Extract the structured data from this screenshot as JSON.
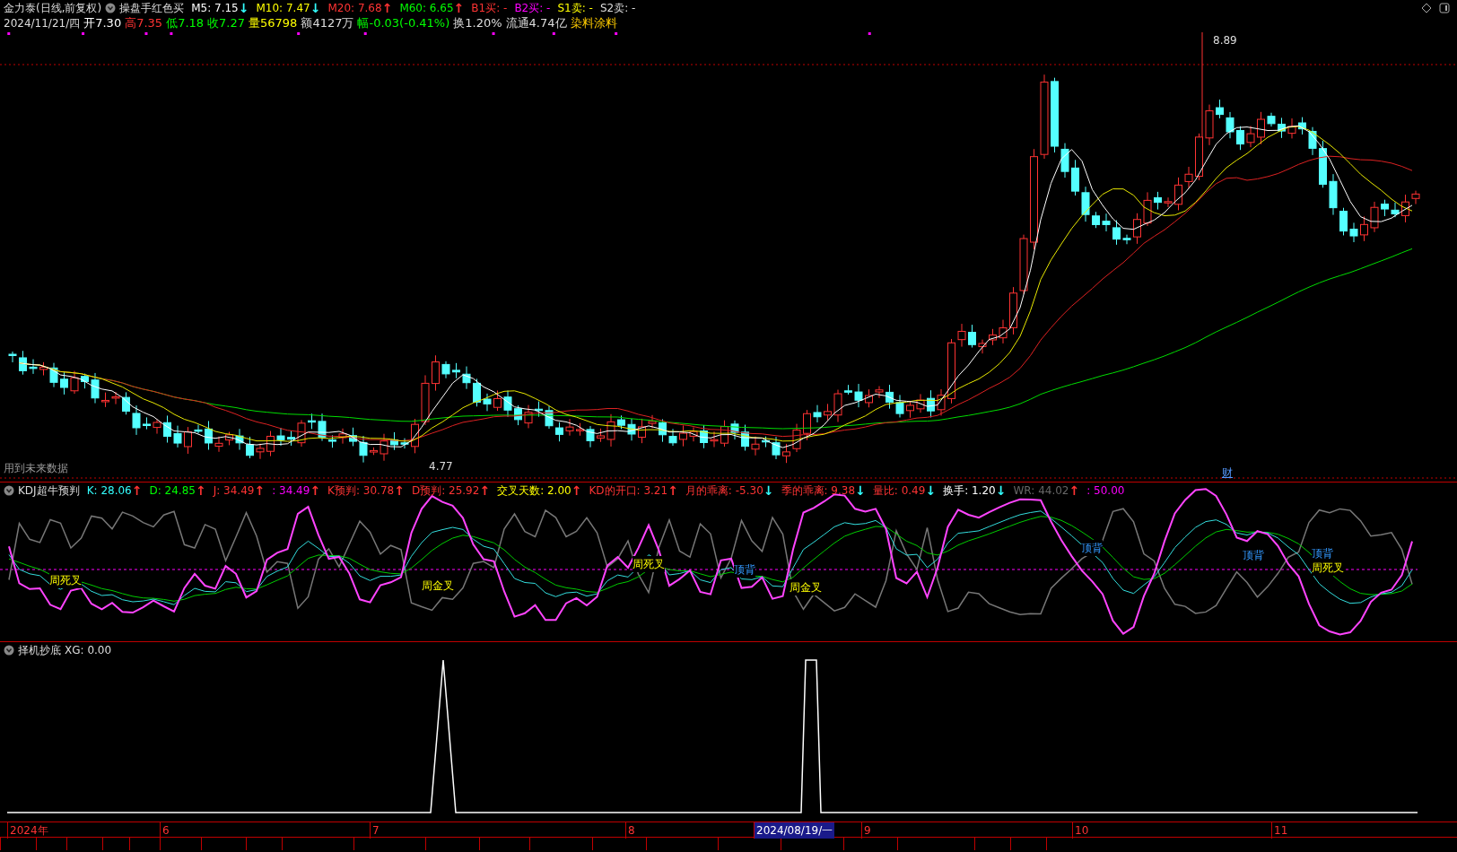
{
  "header": {
    "title": "金力泰(日线,前复权)",
    "indicator": "操盘手红色买",
    "averages": [
      {
        "label": "M5: 7.15",
        "color": "#ffffff",
        "arrow": {
          "symbol": "↓",
          "color": "#33ffff"
        }
      },
      {
        "label": "M10: 7.47",
        "color": "#ffff00",
        "arrow": {
          "symbol": "↓",
          "color": "#33ffff"
        }
      },
      {
        "label": "M20: 7.68",
        "color": "#ff3333",
        "arrow": {
          "symbol": "↑",
          "color": "#ff3333"
        }
      },
      {
        "label": "M60: 6.65",
        "color": "#00ff00",
        "arrow": {
          "symbol": "↑",
          "color": "#ff3333"
        }
      },
      {
        "label": "B1买: -",
        "color": "#ff3333"
      },
      {
        "label": "B2买: -",
        "color": "#ff00ff"
      },
      {
        "label": "S1卖: -",
        "color": "#ffff00"
      },
      {
        "label": "S2卖: -",
        "color": "#dddddd"
      }
    ],
    "date": "2024/11/21/四",
    "quote": [
      {
        "label": "开7.30",
        "color": "#ffffff"
      },
      {
        "label": "高7.35",
        "color": "#ff3333"
      },
      {
        "label": "低7.18",
        "color": "#00ff00"
      },
      {
        "label": "收7.27",
        "color": "#00ff00"
      },
      {
        "label": "量56798",
        "color": "#ffff00"
      },
      {
        "label": "额4127万",
        "color": "#dddddd"
      },
      {
        "label": "幅-0.03(-0.41%)",
        "color": "#00ff00"
      },
      {
        "label": "换1.20%",
        "color": "#dddddd"
      },
      {
        "label": "流通4.74亿",
        "color": "#dddddd"
      },
      {
        "label": "染料涂料",
        "color": "#ffcc00"
      }
    ]
  },
  "price_chart": {
    "high_label": "8.89",
    "low_label": "4.77",
    "note": "用到未来数据",
    "marker": "财"
  },
  "kdj": {
    "title": "KDJ超牛预判",
    "items": [
      {
        "label": "K: 28.06",
        "color": "#33ffff",
        "arrow": {
          "symbol": "↑",
          "color": "#ff3333"
        }
      },
      {
        "label": "D: 24.85",
        "color": "#00ff00",
        "arrow": {
          "symbol": "↑",
          "color": "#ff3333"
        }
      },
      {
        "label": "J: 34.49",
        "color": "#ff3333",
        "arrow": {
          "symbol": "↑",
          "color": "#ff3333"
        }
      },
      {
        "label": ": 34.49",
        "color": "#ff00ff",
        "arrow": {
          "symbol": "↑",
          "color": "#ff3333"
        }
      },
      {
        "label": "K预判: 30.78",
        "color": "#ff3333",
        "arrow": {
          "symbol": "↑",
          "color": "#ff3333"
        }
      },
      {
        "label": "D预判: 25.92",
        "color": "#ff3333",
        "arrow": {
          "symbol": "↑",
          "color": "#ff3333"
        }
      },
      {
        "label": "交叉天数: 2.00",
        "color": "#ffff00",
        "arrow": {
          "symbol": "↑",
          "color": "#ff3333"
        }
      },
      {
        "label": "KD的开口: 3.21",
        "color": "#ff3333",
        "arrow": {
          "symbol": "↑",
          "color": "#ff3333"
        }
      },
      {
        "label": "月的乖离: -5.30",
        "color": "#ff3333",
        "arrow": {
          "symbol": "↓",
          "color": "#33ffff"
        }
      },
      {
        "label": "季的乖离: 9.38",
        "color": "#ff3333",
        "arrow": {
          "symbol": "↓",
          "color": "#33ffff"
        }
      },
      {
        "label": "量比: 0.49",
        "color": "#ff3333",
        "arrow": {
          "symbol": "↓",
          "color": "#33ffff"
        }
      },
      {
        "label": "换手: 1.20",
        "color": "#ffffff",
        "arrow": {
          "symbol": "↓",
          "color": "#33ffff"
        }
      },
      {
        "label": "WR: 44.02",
        "color": "#666666",
        "arrow": {
          "symbol": "↑",
          "color": "#ff3333"
        }
      },
      {
        "label": ": 50.00",
        "color": "#ff00ff"
      }
    ],
    "signals": [
      {
        "label": "周死叉",
        "kind": "cross"
      },
      {
        "label": "周金叉",
        "kind": "cross"
      },
      {
        "label": "周死叉",
        "kind": "cross"
      },
      {
        "label": "顶背",
        "kind": "top"
      },
      {
        "label": "周金叉",
        "kind": "cross"
      },
      {
        "label": "顶背",
        "kind": "top"
      },
      {
        "label": "顶背",
        "kind": "top"
      },
      {
        "label": "顶背",
        "kind": "top"
      },
      {
        "label": "周死叉",
        "kind": "cross"
      }
    ]
  },
  "xg": {
    "title": "择机抄底",
    "reading": "XG: 0.00"
  },
  "time_axis": [
    {
      "label": "2024年",
      "selected": false
    },
    {
      "label": "6",
      "selected": false
    },
    {
      "label": "7",
      "selected": false
    },
    {
      "label": "8",
      "selected": false
    },
    {
      "label": "2024/08/19/一",
      "selected": true
    },
    {
      "label": "9",
      "selected": false
    },
    {
      "label": "10",
      "selected": false
    },
    {
      "label": "11",
      "selected": false
    }
  ]
}
